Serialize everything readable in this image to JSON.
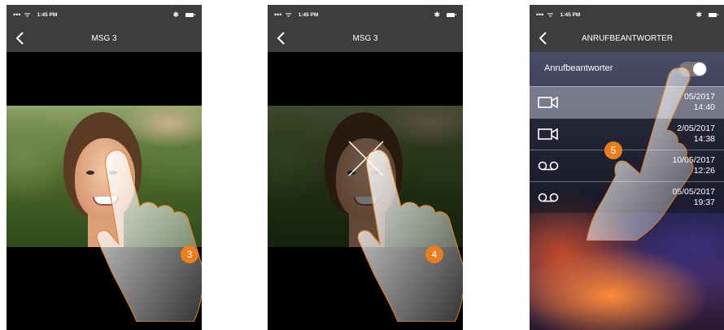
{
  "status_bar": {
    "signal": "•••",
    "wifi": "ᯤ",
    "time": "1:45 PM",
    "bluetooth": "✱"
  },
  "screen1": {
    "title": "MSG 3",
    "step": "3"
  },
  "screen2": {
    "title": "MSG 3",
    "step": "4"
  },
  "screen3": {
    "title": "ANRUFBEANTWORTER",
    "toggle_label": "Anrufbeantworter",
    "toggle_on": true,
    "step": "5",
    "messages": [
      {
        "type": "video",
        "icon": "video-camera-icon",
        "date": "05/2017",
        "time": "14:40"
      },
      {
        "type": "video",
        "icon": "video-camera-icon",
        "date": "2/05/2017",
        "time": "14:38"
      },
      {
        "type": "audio",
        "icon": "voicemail-icon",
        "date": "10/05/2017",
        "time": "12:26"
      },
      {
        "type": "audio",
        "icon": "voicemail-icon",
        "date": "05/05/2017",
        "time": "19:37"
      }
    ]
  },
  "colors": {
    "bar": "#3d3d3d",
    "accent": "#e87e1d"
  }
}
